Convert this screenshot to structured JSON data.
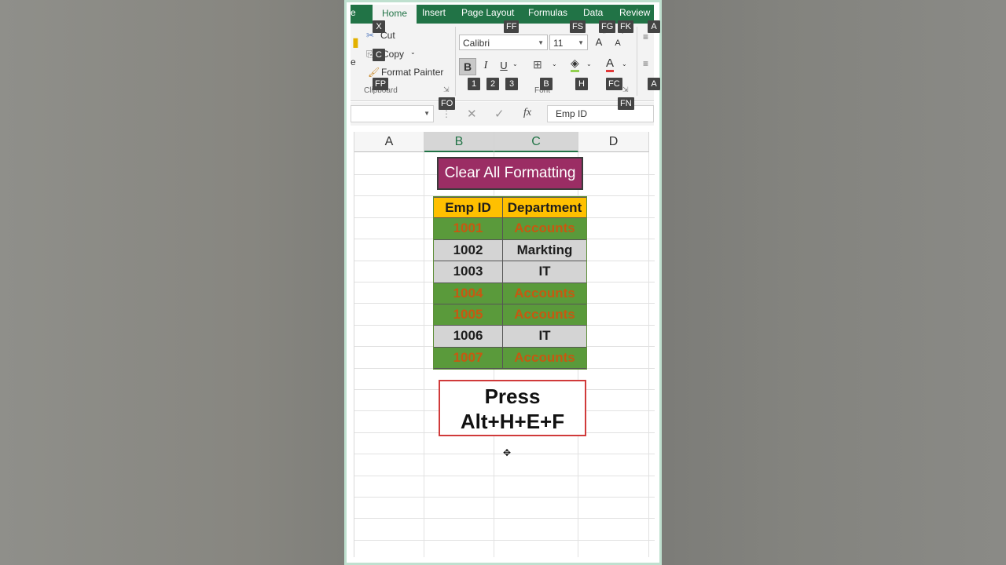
{
  "ribbon": {
    "tabs": [
      {
        "label": "e",
        "active": false
      },
      {
        "label": "Home",
        "active": true
      },
      {
        "label": "Insert",
        "active": false
      },
      {
        "label": "Page Layout",
        "active": false
      },
      {
        "label": "Formulas",
        "active": false
      },
      {
        "label": "Data",
        "active": false
      },
      {
        "label": "Review",
        "active": false
      }
    ],
    "clipboard": {
      "cut": "Cut",
      "copy": "Copy",
      "format_painter": "Format Painter",
      "paste_stub": "e",
      "group_label": "Clipboard"
    },
    "font": {
      "name": "Calibri",
      "size": "11",
      "bold": "B",
      "italic": "I",
      "underline": "U",
      "grow": "A",
      "shrink": "A",
      "font_color": "A",
      "group_label": "Font"
    },
    "keytips": {
      "cut": "X",
      "copy": "C",
      "format_painter": "FP",
      "font_name": "FF",
      "font_size": "FS",
      "grow": "FG",
      "shrink": "FK",
      "align": "A",
      "bold": "1",
      "italic": "2",
      "underline": "3",
      "borders": "B",
      "fill": "H",
      "color": "FC",
      "clipboard_launcher": "FO",
      "font_launcher": "FN",
      "align2": "A"
    },
    "accent": "#217346"
  },
  "formula_bar": {
    "name_box": "",
    "cancel": "✕",
    "enter": "✓",
    "fx": "fx",
    "content": "Emp ID"
  },
  "sheet": {
    "columns": [
      "A",
      "B",
      "C",
      "D"
    ],
    "title": "Clear All Formatting",
    "table": {
      "headers": [
        "Emp ID",
        "Department"
      ],
      "rows": [
        {
          "id": "1001",
          "dept": "Accounts",
          "style": "green"
        },
        {
          "id": "1002",
          "dept": "Markting",
          "style": "gray"
        },
        {
          "id": "1003",
          "dept": "IT",
          "style": "gray"
        },
        {
          "id": "1004",
          "dept": "Accounts",
          "style": "green"
        },
        {
          "id": "1005",
          "dept": "Accounts",
          "style": "green"
        },
        {
          "id": "1006",
          "dept": "IT",
          "style": "gray"
        },
        {
          "id": "1007",
          "dept": "Accounts",
          "style": "green"
        }
      ]
    },
    "instruction": {
      "line1": "Press",
      "line2": "Alt+H+E+F"
    },
    "colors": {
      "title_bg": "#9b2d64",
      "header_bg": "#ffc000",
      "green_bg": "#5a9a3b",
      "green_text": "#c65911",
      "gray_bg": "#d4d4d4",
      "instruction_border": "#d03a3a"
    }
  }
}
